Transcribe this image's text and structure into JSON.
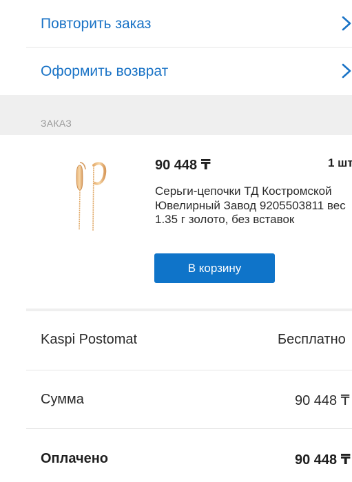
{
  "actions": [
    {
      "label": "Повторить заказ",
      "icon": "chevron-right-icon"
    },
    {
      "label": "Оформить возврат",
      "icon": "chevron-right-icon"
    }
  ],
  "order_section": {
    "title": "ЗАКАЗ"
  },
  "product": {
    "image": "gold-thread-earrings-image",
    "price": "90 448 ₸",
    "quantity": "1 шт",
    "description": "Серьги-цепочки ТД Костромской Ювелирный Завод 9205503811 вес 1.35 г золото, без вставок",
    "cart_button": "В корзину"
  },
  "summary": {
    "delivery_label": "Kaspi Postomat",
    "delivery_value": "Бесплатно",
    "sum_label": "Сумма",
    "sum_value": "90 448 ₸",
    "paid_label": "Оплачено",
    "paid_value": "90 448 ₸"
  },
  "colors": {
    "accent": "#1a73c6",
    "button": "#0f74c9",
    "section_bg": "#efefef"
  }
}
